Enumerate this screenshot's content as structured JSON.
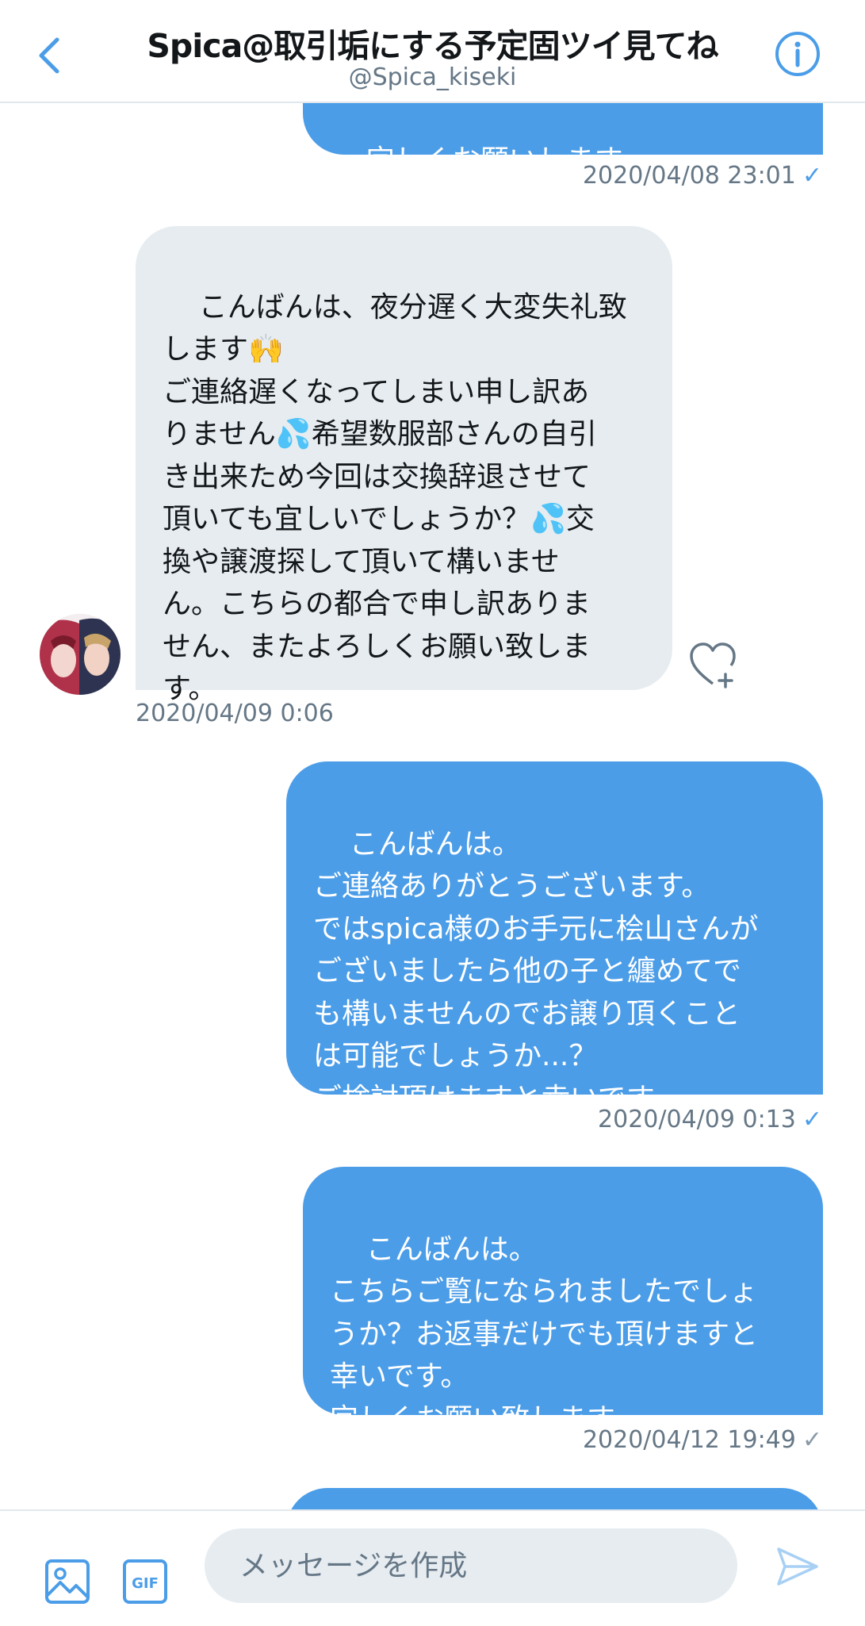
{
  "header": {
    "title": "Spica@取引垢にする予定固ツイ見てね",
    "handle": "@Spica_kiseki",
    "back_icon": "chevron-left-icon",
    "info_icon": "info-circle-icon"
  },
  "messages": [
    {
      "side": "sent",
      "text": "宜しくお願いします。",
      "timestamp": "2020/04/08 23:01",
      "check": "✓"
    },
    {
      "side": "received",
      "text": "こんばんは、夜分遅く大変失礼致\nします🙌\nご連絡遅くなってしまい申し訳あ\nりません💦希望数服部さんの自引\nき出来ため今回は交換辞退させて\n頂いても宜しいでしょうか？💦交\n換や譲渡探して頂いて構いませ\nん。こちらの都合で申し訳ありま\nせん、またよろしくお願い致しま\nす。",
      "timestamp": "2020/04/09 0:06"
    },
    {
      "side": "sent",
      "text": "こんばんは。\nご連絡ありがとうございます。\nではspica様のお手元に桧山さんが\nございましたら他の子と纏めてで\nも構いませんのでお譲り頂くこと\nは可能でしょうか...？\nご検討頂けますと幸いです。",
      "timestamp": "2020/04/09 0:13",
      "check": "✓"
    },
    {
      "side": "sent",
      "text": "こんばんは。\nこちらご覧になられましたでしょ\nうか？お返事だけでも頂けますと\n幸いです。\n宜しくお願い致します。",
      "timestamp": "2020/04/12 19:49",
      "check": "✓"
    }
  ],
  "composer": {
    "placeholder": "メッセージを作成",
    "image_icon": "image-icon",
    "gif_label": "GIF",
    "send_icon": "send-icon"
  },
  "colors": {
    "accent": "#4b9de8",
    "received_bubble": "#e6ecf0",
    "muted_text": "#657786"
  }
}
